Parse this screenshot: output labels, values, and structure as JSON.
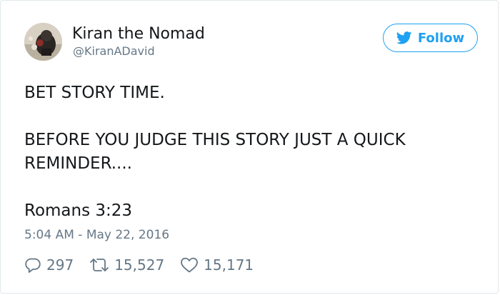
{
  "user": {
    "display_name": "Kiran the Nomad",
    "handle": "@KiranADavid",
    "avatar_icon": "profile-photo"
  },
  "follow_button": {
    "label": "Follow",
    "icon": "twitter-bird-icon",
    "color": "#1da1f2"
  },
  "tweet": {
    "lines": [
      "BET STORY TIME.",
      "BEFORE YOU JUDGE THIS STORY JUST A QUICK REMINDER....",
      "Romans 3:23"
    ],
    "timestamp": "5:04 AM - May 22, 2016"
  },
  "actions": {
    "replies": {
      "icon": "reply-icon",
      "count": "297"
    },
    "retweets": {
      "icon": "retweet-icon",
      "count": "15,527"
    },
    "likes": {
      "icon": "heart-icon",
      "count": "15,171"
    }
  },
  "colors": {
    "text": "#14171a",
    "secondary_text": "#657786",
    "accent": "#1da1f2",
    "border": "#e1e8ed"
  }
}
